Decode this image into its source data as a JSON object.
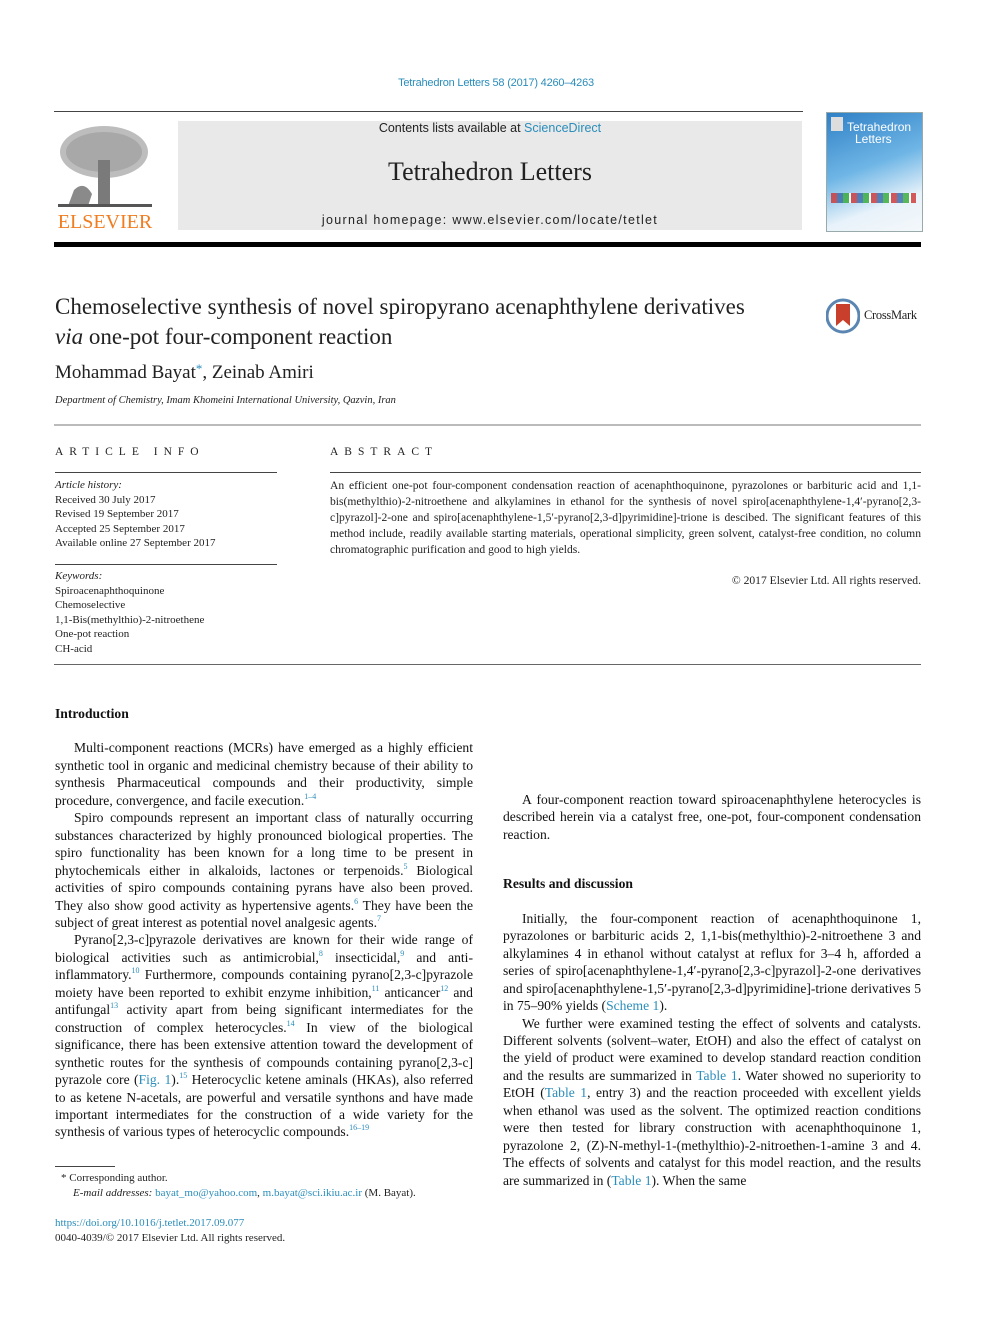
{
  "running_head": "Tetrahedron Letters 58 (2017) 4260–4263",
  "masthead": {
    "publisher_logo_label": "ELSEVIER",
    "contents_prefix": "Contents lists available at ",
    "contents_link": "ScienceDirect",
    "journal_title": "Tetrahedron Letters",
    "homepage": "journal homepage: www.elsevier.com/locate/tetlet",
    "cover_title_line1": "Tetrahedron",
    "cover_title_line2": "Letters"
  },
  "article": {
    "title_part1": "Chemoselective synthesis of novel spiropyrano acenaphthylene derivatives ",
    "title_italic": "via",
    "title_part2": " one-pot four-component reaction",
    "crossmark_label": "CrossMark",
    "author1": "Mohammad Bayat",
    "author1_mark": "*",
    "author_sep": ", ",
    "author2": "Zeinab Amiri",
    "affiliation": "Department of Chemistry, Imam Khomeini International University, Qazvin, Iran"
  },
  "article_info": {
    "heading": "ARTICLE INFO",
    "history_label": "Article history:",
    "history": [
      "Received 30 July 2017",
      "Revised 19 September 2017",
      "Accepted 25 September 2017",
      "Available online 27 September 2017"
    ],
    "keywords_label": "Keywords:",
    "keywords": [
      "Spiroacenaphthoquinone",
      "Chemoselective",
      "1,1-Bis(methylthio)-2-nitroethene",
      "One-pot reaction",
      "CH-acid"
    ]
  },
  "abstract": {
    "heading": "ABSTRACT",
    "text": "An efficient one-pot four-component condensation reaction of acenaphthoquinone, pyrazolones or barbituric acid and 1,1-bis(methylthio)-2-nitroethene and alkylamines in ethanol for the synthesis of novel spiro[acenaphthylene-1,4′-pyrano[2,3-c]pyrazol]-2-one and spiro[acenaphthylene-1,5′-pyrano[2,3-d]pyrimidine]-trione is descibed. The significant features of this method include, readily available starting materials, operational simplicity, green solvent, catalyst-free condition, no column chromatographic purification and good to high yields.",
    "copyright": "© 2017 Elsevier Ltd. All rights reserved."
  },
  "body": {
    "intro_heading": "Introduction",
    "p1": "Multi-component reactions (MCRs) have emerged as a highly efficient synthetic tool in organic and medicinal chemistry because of their ability to synthesis Pharmaceutical compounds and their productivity, simple procedure, convergence, and facile execution.",
    "p1_ref": "1–4",
    "p2a": "Spiro compounds represent an important class of naturally occurring substances characterized by highly pronounced biological properties. The spiro functionality has been known for a long time to be present in phytochemicals either in alkaloids, lactones or terpenoids.",
    "p2_ref1": "5",
    "p2b": " Biological activities of spiro compounds containing pyrans have also been proved. They also show good activity as hypertensive agents.",
    "p2_ref2": "6",
    "p2c": " They have been the subject of great interest as potential novel analgesic agents.",
    "p2_ref3": "7",
    "p3a": "Pyrano[2,3-c]pyrazole derivatives are known for their wide range of biological activities such as antimicrobial,",
    "p3_ref1": "8",
    "p3b": " insecticidal,",
    "p3_ref2": "9",
    "p3c": " and anti-inflammatory.",
    "p3_ref3": "10",
    "p3d": " Furthermore, compounds containing pyrano[2,3-c]pyrazole moiety have been reported to exhibit enzyme inhibition,",
    "p3_ref4": "11",
    "p3e": " anticancer",
    "p3_ref5": "12",
    "p3f": " and antifungal",
    "p3_ref6": "13",
    "p3g": " activity apart from being significant intermediates for the construction of complex heterocycles.",
    "p3_ref7": "14",
    "p3h": " In view of the biological significance, there has been extensive attention toward the development of synthetic routes for the synthesis of compounds containing pyrano[2,3-c] pyrazole core (",
    "p3_fig": "Fig. 1",
    "p3i": ").",
    "p3_ref8": "15",
    "p3j": " Heterocyclic ketene aminals (HKAs), also referred to as ketene N-acetals, are powerful and versatile synthons and have made important intermediates for the construction of a wide variety for the synthesis of various types of heterocyclic compounds.",
    "p3_ref9": "16–19",
    "p4": "A four-component reaction toward spiroacenaphthylene heterocycles is described herein via a catalyst free, one-pot, four-component condensation reaction.",
    "results_heading": "Results and discussion",
    "p5a": "Initially, the four-component reaction of acenaphthoquinone 1, pyrazolones or barbituric acids 2, 1,1-bis(methylthio)-2-nitroethene 3 and alkylamines 4 in ethanol without catalyst at reflux for 3–4 h, afforded a series of spiro[acenaphthylene-1,4′-pyrano[2,3-c]pyrazol]-2-one derivatives and spiro[acenaphthylene-1,5′-pyrano[2,3-d]pyrimidine]-trione derivatives 5 in 75–90% yields (",
    "p5_scheme": "Scheme 1",
    "p5b": ").",
    "p6a": "We further were examined testing the effect of solvents and catalysts. Different solvents (solvent–water, EtOH) and also the effect of catalyst on the yield of product were examined to develop standard reaction condition and the results are summarized in ",
    "p6_t1": "Table 1",
    "p6b": ". Water showed no superiority to EtOH (",
    "p6_t2": "Table 1",
    "p6c": ", entry 3) and the reaction proceeded with excellent yields when ethanol was used as the solvent. The optimized reaction conditions were then tested for library construction with acenaphthoquinone 1, pyrazolone 2, (Z)-N-methyl-1-(methylthio)-2-nitroethen-1-amine 3 and 4. The effects of solvents and catalyst for this model reaction, and the results are summarized in (",
    "p6_t3": "Table 1",
    "p6d": "). When the same"
  },
  "footnotes": {
    "corresponding": "* Corresponding author.",
    "email_label": "E-mail addresses: ",
    "email1": "bayat_mo@yahoo.com",
    "email2": "m.bayat@sci.ikiu.ac.ir",
    "email_owner": " (M. Bayat).",
    "doi": "https://doi.org/10.1016/j.tetlet.2017.09.077",
    "issn": "0040-4039/© 2017 Elsevier Ltd. All rights reserved."
  }
}
